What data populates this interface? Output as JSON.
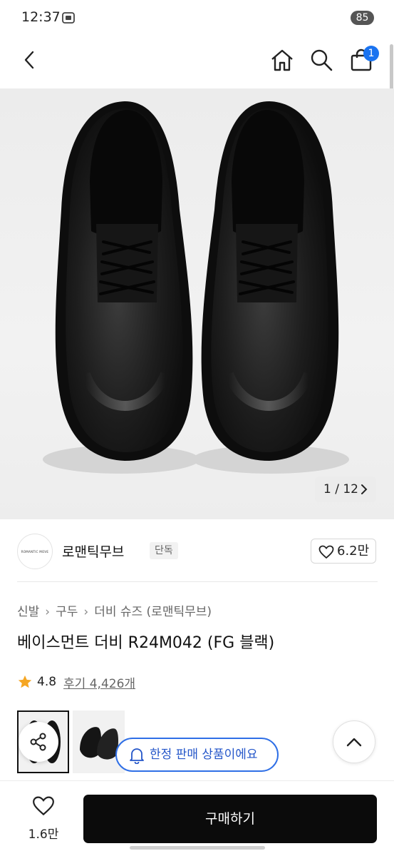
{
  "status_bar": {
    "time": "12:37",
    "battery": "85"
  },
  "nav": {
    "cart_badge": "1",
    "icons": [
      "back-icon",
      "home-icon",
      "search-icon",
      "shopping-bag-icon"
    ]
  },
  "gallery": {
    "counter": "1 / 12"
  },
  "brand": {
    "name": "로맨틱무브",
    "tag": "단독",
    "logo_text": "ROMANTIC MOVE",
    "likes": "6.2만"
  },
  "breadcrumb": [
    "신발",
    "구두",
    "더비 슈즈 (로맨틱무브)"
  ],
  "product": {
    "title": "베이스먼트 더비 R24M042 (FG 블랙)"
  },
  "rating": {
    "score": "4.8",
    "reviews": "후기 4,426개"
  },
  "notice": {
    "limited": "한정 판매 상품이에요"
  },
  "bottom": {
    "wish_count": "1.6만",
    "buy_label": "구매하기"
  },
  "colors": {
    "accent": "#2f6fe6",
    "badge": "#1a73f0",
    "star": "#f5a623",
    "buy_button": "#0b0b0b"
  }
}
